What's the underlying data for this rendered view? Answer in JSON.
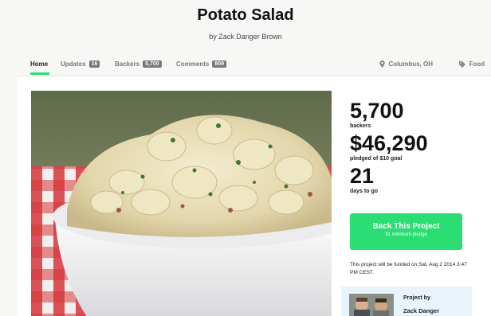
{
  "header": {
    "title": "Potato Salad",
    "byline": "by Zack Danger Brown"
  },
  "nav": {
    "home": "Home",
    "updates": "Updates",
    "updates_count": "16",
    "backers": "Backers",
    "backers_count": "5,700",
    "comments": "Comments",
    "comments_count": "809",
    "location": "Columbus, OH",
    "category": "Food"
  },
  "stats": {
    "backers_value": "5,700",
    "backers_label": "backers",
    "pledged_value": "$46,290",
    "pledged_label": "pledged of $10 goal",
    "days_value": "21",
    "days_label": "days to go"
  },
  "cta": {
    "label": "Back This Project",
    "sublabel": "$1 minimum pledge"
  },
  "funding_note": "This project will be funded on Sat, Aug 2 2014 3:47 PM CEST.",
  "creator": {
    "by_label": "Project by",
    "name": "Zack Danger"
  },
  "colors": {
    "accent": "#2bde73",
    "count_badge": "#777777",
    "creator_bg": "#e9f3fb"
  }
}
